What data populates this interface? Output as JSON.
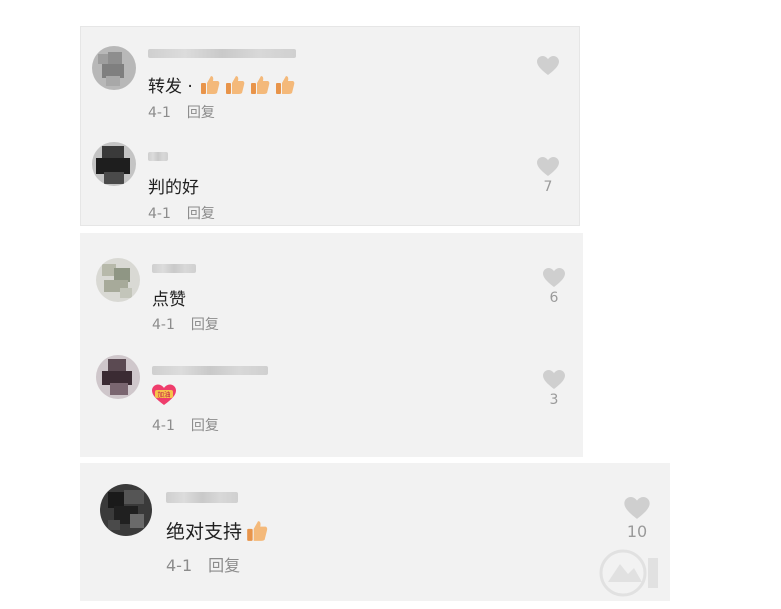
{
  "colors": {
    "panel_bg": "#f2f2f2",
    "text": "#1f1f1f",
    "meta": "#8c8c8c",
    "heart": "#cfcfcf",
    "thumb": "#f0b070"
  },
  "comments": [
    {
      "text": "转发 ·",
      "emoji": [
        "thumbs-up",
        "thumbs-up",
        "thumbs-up",
        "thumbs-up"
      ],
      "date": "4-1",
      "reply_label": "回复",
      "likes": ""
    },
    {
      "text": "判的好",
      "emoji": [],
      "date": "4-1",
      "reply_label": "回复",
      "likes": "7"
    },
    {
      "text": "点赞",
      "emoji": [],
      "date": "4-1",
      "reply_label": "回复",
      "likes": "6"
    },
    {
      "text": "",
      "emoji": [
        "jiayou-sticker"
      ],
      "sticker_text": "加油",
      "date": "4-1",
      "reply_label": "回复",
      "likes": "3"
    },
    {
      "text": "绝对支持",
      "emoji": [
        "thumbs-up"
      ],
      "date": "4-1",
      "reply_label": "回复",
      "likes": "10"
    }
  ]
}
